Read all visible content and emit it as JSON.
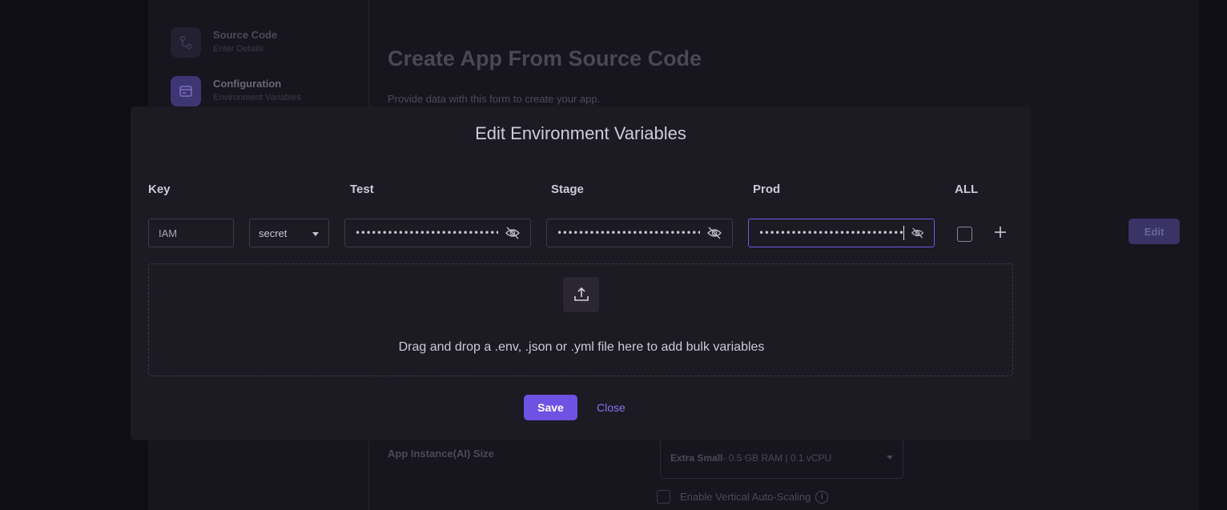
{
  "background": {
    "steps": [
      {
        "title": "Source Code",
        "subtitle": "Enter Details"
      },
      {
        "title": "Configuration",
        "subtitle": "Environment Variables"
      }
    ],
    "page_title": "Create App From Source Code",
    "page_subtitle": "Provide data with this form to create your app.",
    "edit_label": "Edit",
    "instance_label": "App Instance(AI) Size",
    "instance_value_bold": "Extra Small",
    "instance_value_rest": " - 0.5 GB RAM | 0.1 vCPU",
    "autoscale_label": "Enable Vertical Auto-Scaling",
    "info_glyph": "i"
  },
  "modal": {
    "title": "Edit Environment Variables",
    "columns": {
      "key": "Key",
      "test": "Test",
      "stage": "Stage",
      "prod": "Prod",
      "all": "ALL"
    },
    "row": {
      "key_value": "IAM",
      "type_value": "secret",
      "test_value": "•••••••••••••••••••••••••••••••",
      "stage_value": "•••••••••••••••••••••••••••••••",
      "prod_value": "•••••••••••••••••••••••••••••••"
    },
    "dropzone_text": "Drag and drop a .env, .json or .yml file here to add bulk variables",
    "save_label": "Save",
    "close_label": "Close"
  },
  "colors": {
    "accent": "#6d52e3",
    "link": "#8a74f0",
    "modal_bg": "#1c1a22"
  },
  "icons": [
    "source-code-icon",
    "configuration-icon",
    "eye-off-icon",
    "plus-icon",
    "upload-icon",
    "chevron-down-icon"
  ]
}
